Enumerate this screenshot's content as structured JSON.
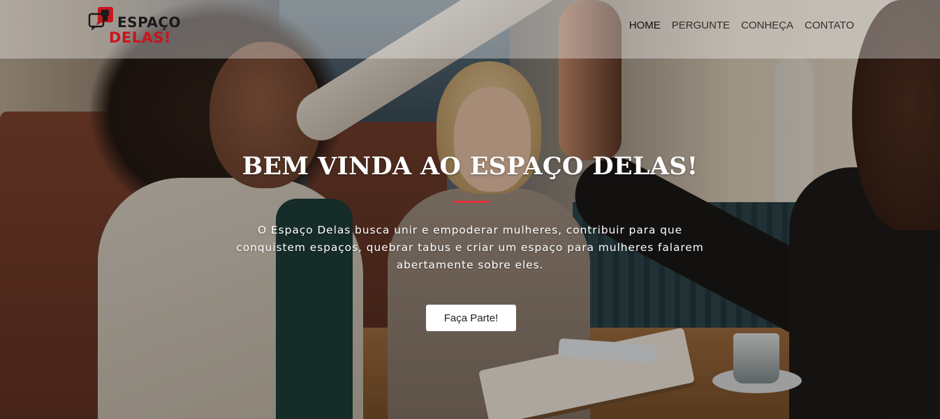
{
  "brand": {
    "logo_line1": "ESPAÇO",
    "logo_line2": "DELAS!",
    "accent_color": "#c7161c",
    "icon": "raised-fist-speech-bubble-icon"
  },
  "nav": {
    "items": [
      {
        "label": "HOME",
        "active": true
      },
      {
        "label": "PERGUNTE",
        "active": false
      },
      {
        "label": "CONHEÇA",
        "active": false
      },
      {
        "label": "CONTATO",
        "active": false
      }
    ]
  },
  "hero": {
    "title": "BEM VINDA AO ESPAÇO DELAS!",
    "divider_color": "#e0303a",
    "text": "O Espaço Delas busca unir e empoderar mulheres, contribuir para que conquistem espaços, quebrar tabus e criar um espaço para mulheres falarem abertamente sobre eles.",
    "cta_label": "Faça Parte!"
  }
}
